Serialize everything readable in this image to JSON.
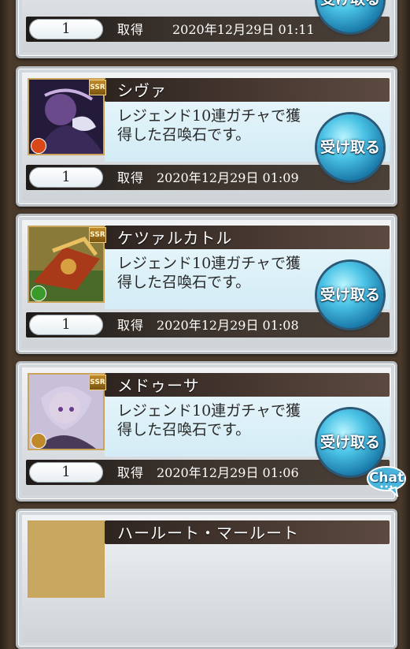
{
  "items": [
    {
      "name": "",
      "description": "",
      "count": "1",
      "date_label": "取得",
      "date": "2020年12月29日 01:11",
      "button_label": "受け取る",
      "rarity": "",
      "element_color": "#c84818"
    },
    {
      "name": "シヴァ",
      "description": "レジェンド10連ガチャで獲得した召喚石です。",
      "count": "1",
      "date_label": "取得",
      "date": "2020年12月29日 01:09",
      "button_label": "受け取る",
      "rarity": "SSR",
      "element_color": "#d84818"
    },
    {
      "name": "ケツァルカトル",
      "description": "レジェンド10連ガチャで獲得した召喚石です。",
      "count": "1",
      "date_label": "取得",
      "date": "2020年12月29日 01:08",
      "button_label": "受け取る",
      "rarity": "SSR",
      "element_color": "#3a9a2a"
    },
    {
      "name": "メドゥーサ",
      "description": "レジェンド10連ガチャで獲得した召喚石です。",
      "count": "1",
      "date_label": "取得",
      "date": "2020年12月29日 01:06",
      "button_label": "受け取る",
      "rarity": "SSR",
      "element_color": "#c08a2a"
    },
    {
      "name": "ハールート・マールート",
      "description": "",
      "count": "",
      "date_label": "",
      "date": "",
      "button_label": "",
      "rarity": "",
      "element_color": "#c08a2a"
    }
  ],
  "chat_label": "Chat"
}
